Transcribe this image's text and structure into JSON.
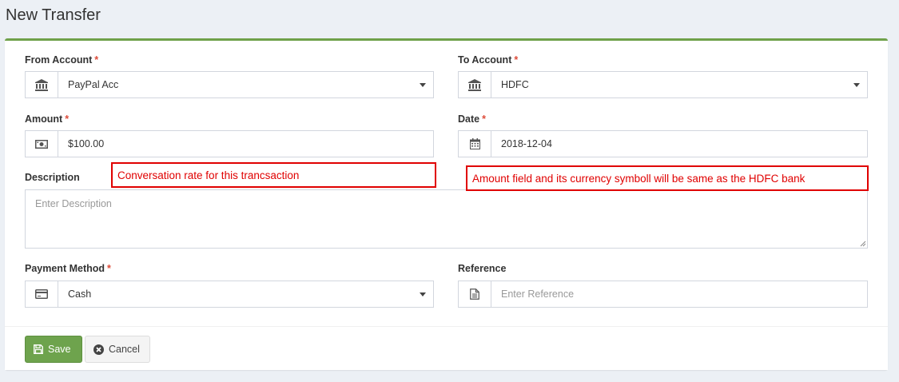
{
  "page": {
    "title": "New Transfer"
  },
  "form": {
    "from_account": {
      "label": "From Account",
      "required": "*",
      "value": "PayPal Acc",
      "icon": "bank-icon"
    },
    "to_account": {
      "label": "To Account",
      "required": "*",
      "value": "HDFC",
      "icon": "bank-icon"
    },
    "amount": {
      "label": "Amount",
      "required": "*",
      "value": "$100.00",
      "icon": "money-icon"
    },
    "date": {
      "label": "Date",
      "required": "*",
      "value": "2018-12-04",
      "icon": "calendar-icon"
    },
    "description": {
      "label": "Description",
      "placeholder": "Enter Description"
    },
    "payment_method": {
      "label": "Payment Method",
      "required": "*",
      "value": "Cash",
      "icon": "credit-card-icon"
    },
    "reference": {
      "label": "Reference",
      "placeholder": "Enter Reference",
      "icon": "document-icon"
    }
  },
  "annotations": {
    "rate_note": "Conversation rate for this trancsaction",
    "amount_note": "Amount field and its currency symboll will be same as the HDFC bank"
  },
  "actions": {
    "save_label": "Save",
    "cancel_label": "Cancel"
  },
  "colors": {
    "accent_green": "#6ea34d",
    "required_red": "#dd4b39",
    "annotation_red": "#e00000"
  }
}
